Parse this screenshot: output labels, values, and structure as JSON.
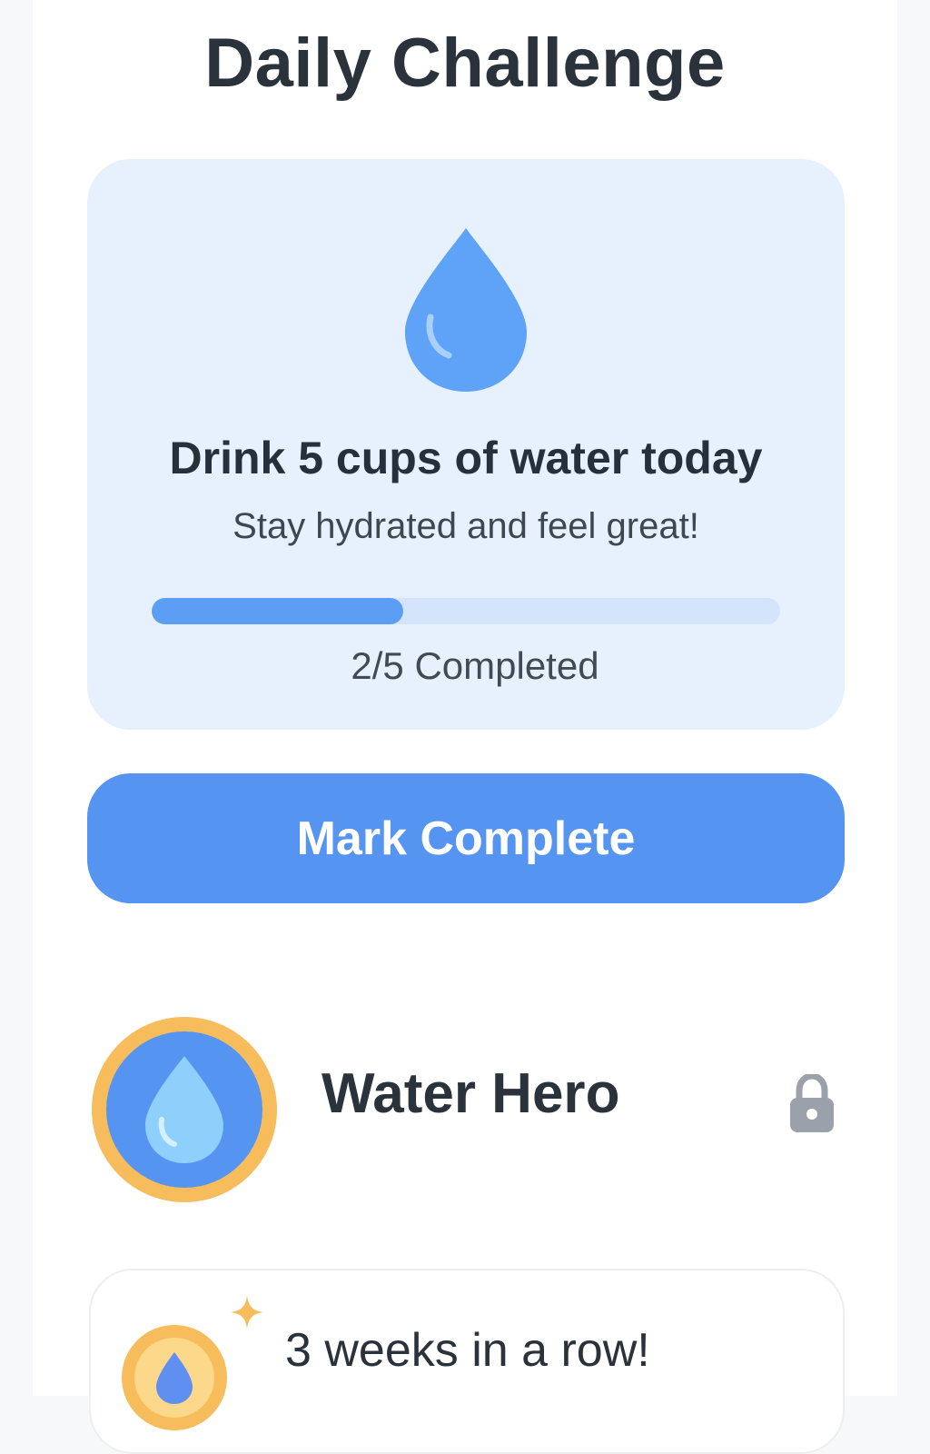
{
  "header": {
    "title": "Daily Challenge"
  },
  "challenge": {
    "icon": "water-drop-icon",
    "title": "Drink 5 cups of water today",
    "subtitle": "Stay hydrated and feel great!",
    "progress": {
      "completed": 2,
      "total": 5,
      "fraction": 0.4,
      "label": "2/5 Completed"
    }
  },
  "actions": {
    "mark_complete_label": "Mark Complete"
  },
  "badge": {
    "name": "Water Hero",
    "icon": "water-badge-icon",
    "status_icon": "lock-icon",
    "locked": true
  },
  "streak": {
    "text": "3 weeks in a row!",
    "icon": "streak-medal-icon",
    "sparkle_icon": "sparkle-icon"
  },
  "colors": {
    "accent": "#5594f1",
    "card_bg": "#e7f1fd",
    "progress_fill": "#5b9ef3",
    "progress_track": "#d4e4fa",
    "badge_ring": "#f7bd5c",
    "badge_inner": "#5594f1",
    "lock": "#9aa1ab"
  }
}
